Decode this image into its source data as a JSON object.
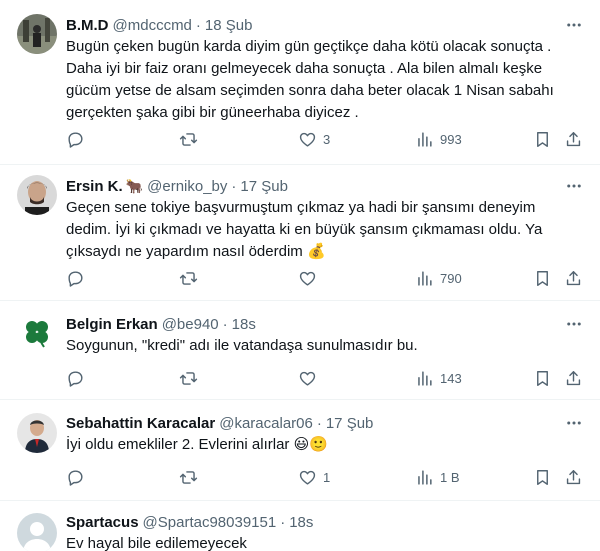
{
  "tweets": [
    {
      "name": "B.M.D",
      "name_emoji": "",
      "handle": "@mdcccmd",
      "time": "18 Şub",
      "lines": [
        "Bugün çeken bugün karda diyim gün geçtikçe daha kötü olacak sonuçta .",
        "Daha iyi bir faiz oranı gelmeyecek daha sonuçta . Ala bilen almalı keşke",
        "gücüm yetse de alsam seçimden sonra daha beter olacak 1 Nisan sabahı",
        "gerçekten şaka gibi bir güneerhaba diyicez ."
      ],
      "replies": "",
      "retweets": "",
      "likes": "3",
      "views": "993"
    },
    {
      "name": "Ersin K.",
      "name_emoji": "🐂",
      "handle": "@erniko_by",
      "time": "17 Şub",
      "lines": [
        "Geçen sene tokiye başvurmuştum çıkmaz ya hadi bir şansımı deneyim",
        "dedim. İyi ki çıkmadı ve hayatta ki en büyük şansım çıkmaması oldu. Ya",
        "çıksaydı ne yapardım nasıl öderdim 💰"
      ],
      "replies": "",
      "retweets": "",
      "likes": "",
      "views": "790"
    },
    {
      "name": "Belgin Erkan",
      "name_emoji": "",
      "handle": "@be940",
      "time": "18s",
      "lines": [
        "Soygunun, \"kredi\" adı ile vatandaşa sunulmasıdır bu."
      ],
      "replies": "",
      "retweets": "",
      "likes": "",
      "views": "143"
    },
    {
      "name": "Sebahattin Karacalar",
      "name_emoji": "",
      "handle": "@karacalar06",
      "time": "17 Şub",
      "lines": [
        "İyi oldu emekliler 2. Evlerini alırlar 😃🙂"
      ],
      "replies": "",
      "retweets": "",
      "likes": "1",
      "views": "1 B"
    },
    {
      "name": "Spartacus",
      "name_emoji": "",
      "handle": "@Spartac98039151",
      "time": "18s",
      "lines": [
        "Ev hayal bile edilemeyecek"
      ]
    }
  ]
}
